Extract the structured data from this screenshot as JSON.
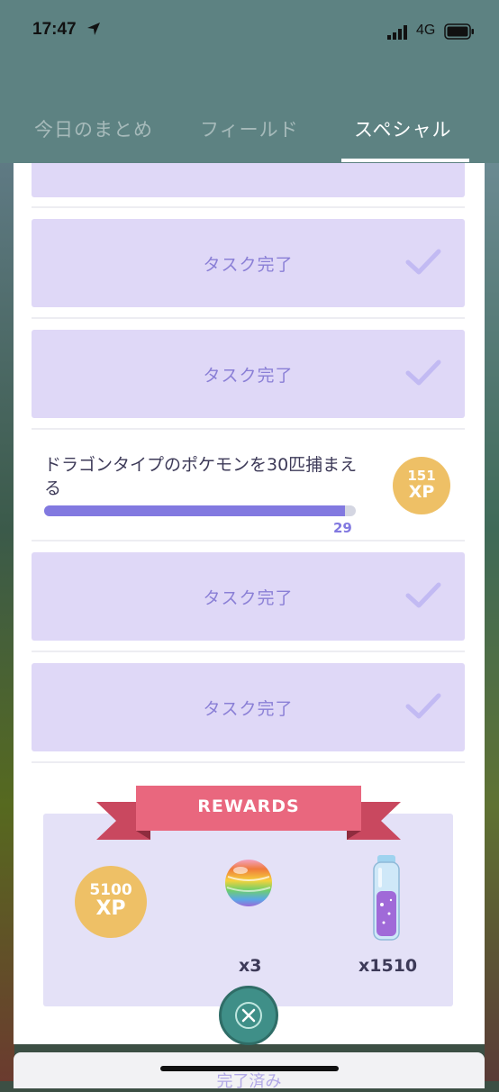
{
  "status_bar": {
    "time": "17:47",
    "network": "4G"
  },
  "tabs": [
    {
      "label": "今日のまとめ",
      "active": false
    },
    {
      "label": "フィールド",
      "active": false
    },
    {
      "label": "スペシャル",
      "active": true
    }
  ],
  "tasks": {
    "completed_label": "タスク完了",
    "current": {
      "text": "ドラゴンタイプのポケモンを30匹捕まえる",
      "progress": 29,
      "goal": 30,
      "reward_xp": "151",
      "xp_unit": "XP"
    }
  },
  "rewards": {
    "title": "REWARDS",
    "xp_amount": "5100",
    "xp_unit": "XP",
    "items": [
      {
        "icon": "rare-candy-icon",
        "quantity": "x3"
      },
      {
        "icon": "stardust-potion-icon",
        "quantity": "x1510"
      }
    ]
  },
  "bottom_sheet": {
    "label": "完了済み"
  },
  "colors": {
    "header": "#5d8282",
    "task_card": "#dfd8f7",
    "task_text": "#8a7fd6",
    "progress": "#8279e0",
    "xp_badge": "#eec066",
    "ribbon": "#e9677e",
    "close_button": "#3f8f88"
  }
}
